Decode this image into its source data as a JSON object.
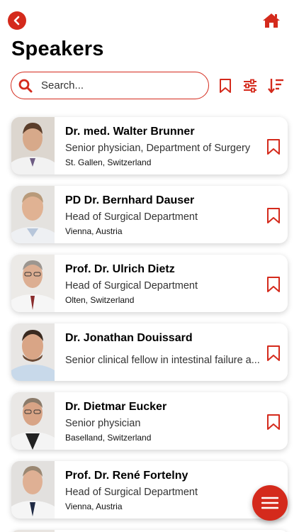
{
  "header": {
    "back_icon": "chevron-left-icon",
    "home_icon": "home-icon",
    "title": "Speakers"
  },
  "search": {
    "placeholder": "Search...",
    "value": ""
  },
  "toolbar": {
    "bookmark_filter_icon": "bookmark-icon",
    "filter_icon": "sliders-icon",
    "sort_icon": "sort-descending-icon"
  },
  "accent_color": "#d42a1c",
  "speakers": [
    {
      "name": "Dr. med. Walter Brunner",
      "role": "Senior physician, Department of Surgery",
      "location": "St. Gallen, Switzerland"
    },
    {
      "name": "PD Dr. Bernhard Dauser",
      "role": "Head of Surgical Department",
      "location": "Vienna, Austria"
    },
    {
      "name": "Prof. Dr. Ulrich Dietz",
      "role": "Head of Surgical Department",
      "location": "Olten, Switzerland"
    },
    {
      "name": "Dr. Jonathan Douissard",
      "role": "Senior clinical fellow in intestinal failure a...",
      "location": ""
    },
    {
      "name": "Dr. Dietmar Eucker",
      "role": "Senior physician",
      "location": "Baselland, Switzerland"
    },
    {
      "name": "Prof. Dr. René Fortelny",
      "role": "Head of Surgical Department",
      "location": "Vienna, Austria"
    }
  ],
  "fab": {
    "icon": "menu-icon"
  }
}
